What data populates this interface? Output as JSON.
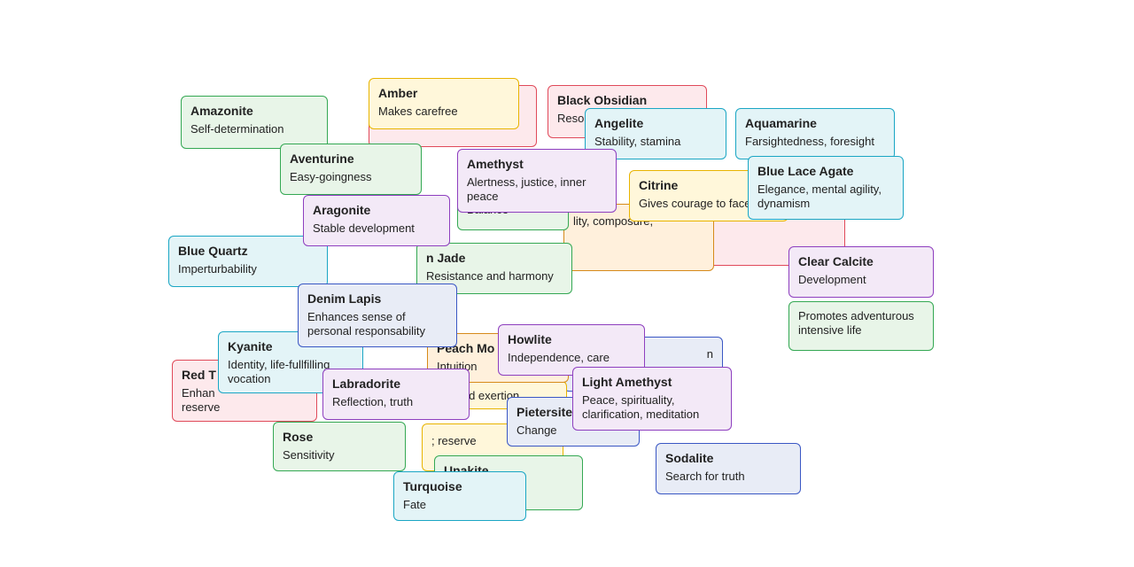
{
  "cards": {
    "amazonite": {
      "title": "Amazonite",
      "desc": "Self-determination"
    },
    "amber": {
      "title": "Amber",
      "desc": "Makes carefree"
    },
    "black_obsidian": {
      "title": "Black Obsidian",
      "desc": "Resolu"
    },
    "angelite": {
      "title": "Angelite",
      "desc": "Stability, stamina"
    },
    "aquamarine": {
      "title": "Aquamarine",
      "desc": "Farsightedness, foresight"
    },
    "aventurine": {
      "title": "Aventurine",
      "desc": "Easy-goingness"
    },
    "amethyst": {
      "title": "Amethyst",
      "desc": "Alertness, justice, inner peace"
    },
    "citrine": {
      "title": "Citrine",
      "desc": "Gives courage to face life."
    },
    "blue_lace": {
      "title": "Blue Lace Agate",
      "desc": "Elegance, mental agility, dynamism"
    },
    "aragonite": {
      "title": "Aragonite",
      "desc": "Stable development"
    },
    "balance": {
      "title": "",
      "desc": "Balance"
    },
    "orange_frag": {
      "title": "",
      "desc": "lity, composure,"
    },
    "blue_quartz": {
      "title": "Blue Quartz",
      "desc": "Imperturbability"
    },
    "n_jade": {
      "title": "n Jade",
      "desc": "Resistance and harmony"
    },
    "clear_calcite": {
      "title": "Clear Calcite",
      "desc": "Development"
    },
    "adventurous": {
      "title": "",
      "desc": "Promotes adventurous intensive life"
    },
    "denim_lapis": {
      "title": "Denim Lapis",
      "desc": "Enhances sense of personal responsability"
    },
    "kyanite": {
      "title": "Kyanite",
      "desc": "Identity, life-fullfilling vocation"
    },
    "peach_mo": {
      "title": "Peach Mo",
      "desc": "Intuition"
    },
    "howlite": {
      "title": "Howlite",
      "desc": "Independence, care"
    },
    "red_t": {
      "title": "Red T",
      "desc": "Enhan\nreserve"
    },
    "labradorite": {
      "title": "Labradorite",
      "desc": "Reflection, truth"
    },
    "tand_exertion": {
      "title": "",
      "desc": "tand exertion"
    },
    "light_amethyst": {
      "title": "Light Amethyst",
      "desc": "Peace, spirituality, clarification, meditation"
    },
    "pietersite": {
      "title": "Pietersite",
      "desc": "Change"
    },
    "rose": {
      "title": "Rose",
      "desc": "Sensitivity"
    },
    "reserve": {
      "title": "",
      "desc": "; reserve"
    },
    "sodalite": {
      "title": "Sodalite",
      "desc": "Search for truth"
    },
    "unakite": {
      "title": "Unakite",
      "desc": ""
    },
    "turquoise": {
      "title": "Turquoise",
      "desc": "Fate"
    },
    "pink_frag": {
      "title": "",
      "desc": ""
    },
    "slate_frag": {
      "title": "",
      "desc": "n"
    },
    "red_frag": {
      "title": "",
      "desc": ""
    }
  }
}
